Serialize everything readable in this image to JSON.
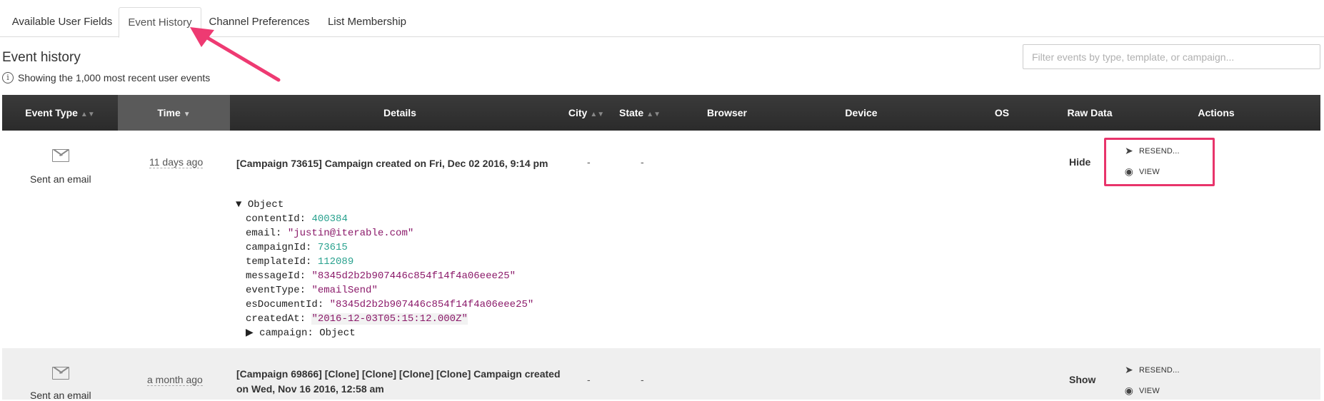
{
  "tabs": [
    {
      "label": "Available User Fields",
      "active": false
    },
    {
      "label": "Event History",
      "active": true
    },
    {
      "label": "Channel Preferences",
      "active": false
    },
    {
      "label": "List Membership",
      "active": false
    }
  ],
  "section": {
    "title": "Event history",
    "info": "Showing the 1,000 most recent user events",
    "info_icon": "info-icon"
  },
  "filter": {
    "placeholder": "Filter events by type, template, or campaign...",
    "value": ""
  },
  "columns": {
    "event_type": "Event Type",
    "time": "Time",
    "details": "Details",
    "city": "City",
    "state": "State",
    "browser": "Browser",
    "device": "Device",
    "os": "OS",
    "raw_data": "Raw Data",
    "actions": "Actions"
  },
  "rows": [
    {
      "event_type": "Sent an email",
      "time": "11 days ago",
      "details_prefix": "[Campaign 73615]",
      "details_text": " Campaign created on Fri, Dec 02 2016, 9:14 pm",
      "city": "-",
      "state": "-",
      "raw_toggle": "Hide",
      "resend": "RESEND...",
      "view": "VIEW",
      "raw": {
        "root": "Object",
        "contentId": "400384",
        "email": "\"justin@iterable.com\"",
        "campaignId": "73615",
        "templateId": "112089",
        "messageId": "\"8345d2b2b907446c854f14f4a06eee25\"",
        "eventType": "\"emailSend\"",
        "esDocumentId": "\"8345d2b2b907446c854f14f4a06eee25\"",
        "createdAt": "\"2016-12-03T05:15:12.000Z\"",
        "campaign": "Object"
      }
    },
    {
      "event_type": "Sent an email",
      "time": "a month ago",
      "details_line1": "[Campaign 69866] [Clone] [Clone] [Clone] [Clone] Campaign created",
      "details_line2": "on Wed, Nov 16 2016, 12:58 am",
      "city": "-",
      "state": "-",
      "raw_toggle": "Show",
      "resend": "RESEND...",
      "view": "VIEW"
    }
  ],
  "accent": "#e8346b"
}
